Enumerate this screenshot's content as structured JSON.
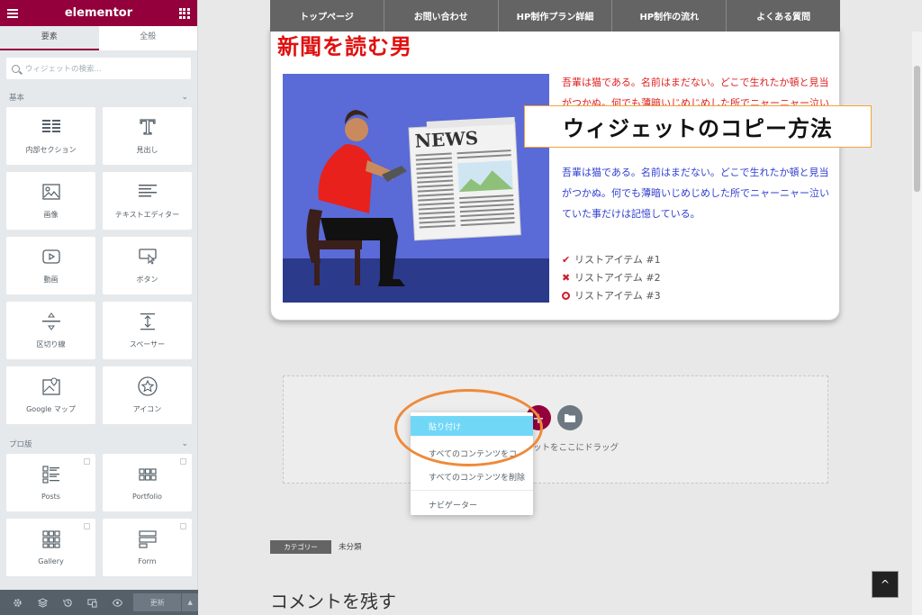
{
  "sidebar": {
    "logo": "elementor",
    "tabs": [
      {
        "label": "要素",
        "active": true
      },
      {
        "label": "全般",
        "active": false
      }
    ],
    "search_placeholder": "ウィジェットの検索...",
    "categories": {
      "basic": "基本",
      "pro": "プロ版"
    },
    "basic_widgets": [
      {
        "label": "内部セクション",
        "icon": "inner-section-icon"
      },
      {
        "label": "見出し",
        "icon": "heading-icon"
      },
      {
        "label": "画像",
        "icon": "image-icon"
      },
      {
        "label": "テキストエディター",
        "icon": "text-editor-icon"
      },
      {
        "label": "動画",
        "icon": "video-icon"
      },
      {
        "label": "ボタン",
        "icon": "button-icon"
      },
      {
        "label": "区切り線",
        "icon": "divider-icon"
      },
      {
        "label": "スペーサー",
        "icon": "spacer-icon"
      },
      {
        "label": "Google マップ",
        "icon": "google-maps-icon"
      },
      {
        "label": "アイコン",
        "icon": "star-icon"
      }
    ],
    "pro_widgets": [
      {
        "label": "Posts",
        "icon": "posts-icon"
      },
      {
        "label": "Portfolio",
        "icon": "portfolio-icon"
      },
      {
        "label": "Gallery",
        "icon": "gallery-icon"
      },
      {
        "label": "Form",
        "icon": "form-icon"
      }
    ],
    "footer": {
      "update_label": "更新"
    }
  },
  "nav": {
    "items": [
      "トップページ",
      "お問い合わせ",
      "HP制作プラン詳細",
      "HP制作の流れ",
      "よくある質問"
    ]
  },
  "card": {
    "title": "新聞を読む男",
    "para_red": "吾輩は猫である。名前はまだない。どこで生れたか頓と見当がつかぬ。何でも薄暗いじめじめした所でニャーニャー泣いていた事だけは記憶している。",
    "para_blue": "吾輩は猫である。名前はまだない。どこで生れたか頓と見当がつかぬ。何でも薄暗いじめじめした所でニャーニャー泣いていた事だけは記憶している。",
    "list": [
      {
        "label": "リストアイテム #1",
        "icon": "check-icon"
      },
      {
        "label": "リストアイテム #2",
        "icon": "times-icon"
      },
      {
        "label": "リストアイテム #3",
        "icon": "dot-circle-icon"
      }
    ],
    "image_text": "NEWS"
  },
  "overlay_title": "ウィジェットのコピー方法",
  "dropzone": {
    "text": "ットをここにドラッグ"
  },
  "context_menu": {
    "items": [
      "貼り付け",
      "すべてのコンテンツをコ",
      "すべてのコンテンツを削除",
      "ナビゲーター"
    ]
  },
  "post_meta": {
    "category_label": "カテゴリー",
    "category_value": "未分類"
  },
  "comment_heading": "コメントを残す",
  "colors": {
    "elementor": "#93003c",
    "nav": "#646464",
    "title_red": "#e01010",
    "highlight": "#71d7f7",
    "ring": "#ee8a3a"
  }
}
